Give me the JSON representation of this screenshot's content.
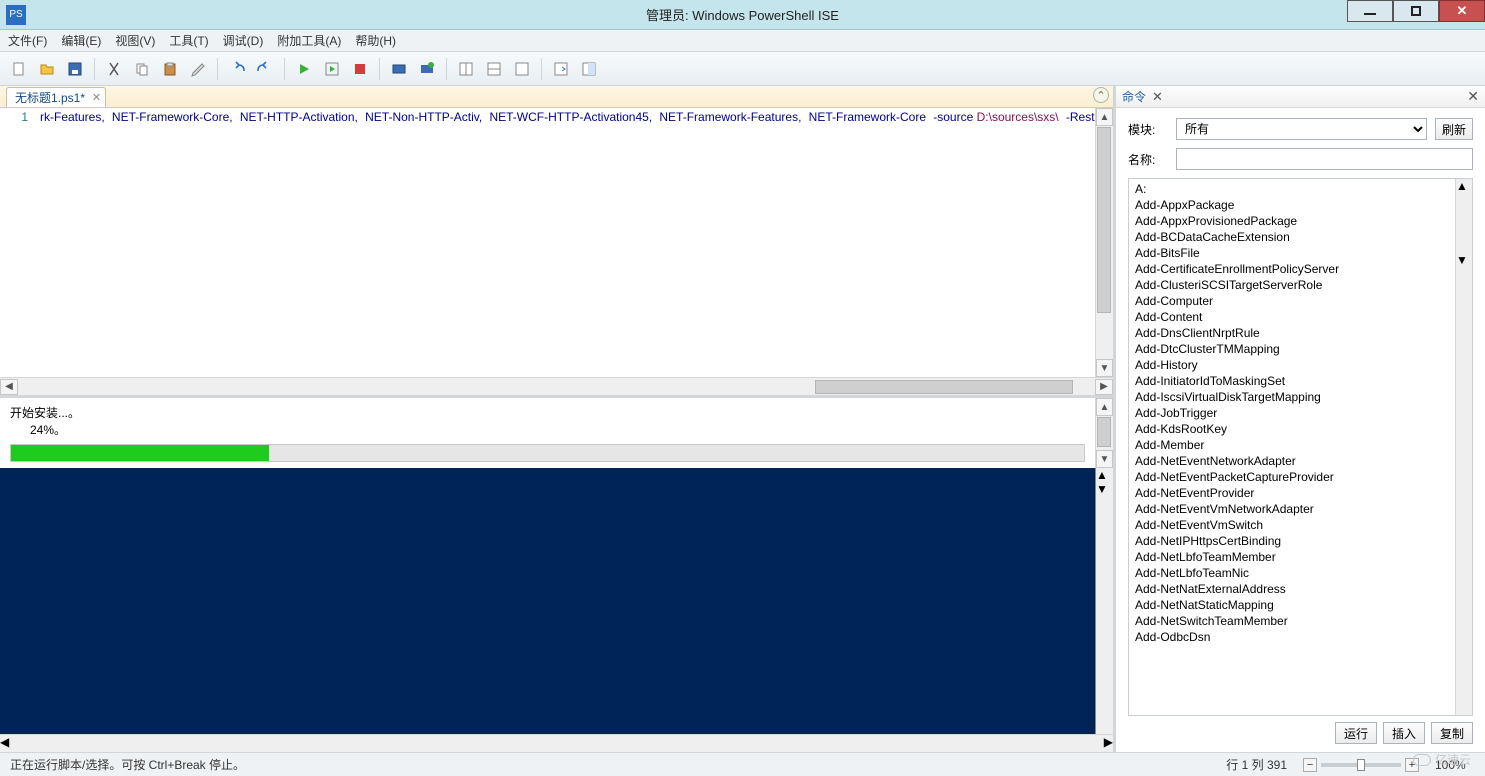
{
  "window": {
    "title": "管理员: Windows PowerShell ISE"
  },
  "menus": {
    "file": "文件(F)",
    "edit": "编辑(E)",
    "view": "视图(V)",
    "tools": "工具(T)",
    "debug": "调试(D)",
    "addons": "附加工具(A)",
    "help": "帮助(H)"
  },
  "tab": {
    "name": "无标题1.ps1*"
  },
  "code": {
    "line_no": "1",
    "seg1": "rk-Features,",
    "seg2": "NET-Framework-Core,",
    "seg3": "NET-HTTP-Activation,",
    "seg4": "NET-Non-HTTP-Activ,",
    "seg5": "NET-WCF-HTTP-Activation45,",
    "seg6": "NET-Framework-Features,",
    "seg7": "NET-Framework-Core",
    "sw1": " -source ",
    "path": "D:\\sources\\sxs\\",
    "sw2": " -Restart"
  },
  "output": {
    "line1": "开始安装...。",
    "line2": "24%。",
    "progress": 24
  },
  "commands": {
    "panel_label": "命令",
    "module_label": "模块:",
    "module_value": "所有",
    "refresh": "刷新",
    "name_label": "名称:",
    "group": "A:",
    "items": [
      "Add-AppxPackage",
      "Add-AppxProvisionedPackage",
      "Add-BCDataCacheExtension",
      "Add-BitsFile",
      "Add-CertificateEnrollmentPolicyServer",
      "Add-ClusteriSCSITargetServerRole",
      "Add-Computer",
      "Add-Content",
      "Add-DnsClientNrptRule",
      "Add-DtcClusterTMMapping",
      "Add-History",
      "Add-InitiatorIdToMaskingSet",
      "Add-IscsiVirtualDiskTargetMapping",
      "Add-JobTrigger",
      "Add-KdsRootKey",
      "Add-Member",
      "Add-NetEventNetworkAdapter",
      "Add-NetEventPacketCaptureProvider",
      "Add-NetEventProvider",
      "Add-NetEventVmNetworkAdapter",
      "Add-NetEventVmSwitch",
      "Add-NetIPHttpsCertBinding",
      "Add-NetLbfoTeamMember",
      "Add-NetLbfoTeamNic",
      "Add-NetNatExternalAddress",
      "Add-NetNatStaticMapping",
      "Add-NetSwitchTeamMember",
      "Add-OdbcDsn"
    ],
    "run": "运行",
    "insert": "插入",
    "copy": "复制"
  },
  "status": {
    "msg": "正在运行脚本/选择。可按 Ctrl+Break 停止。",
    "pos": "行 1 列 391",
    "zoom": "100%"
  },
  "watermark": "亿速云"
}
